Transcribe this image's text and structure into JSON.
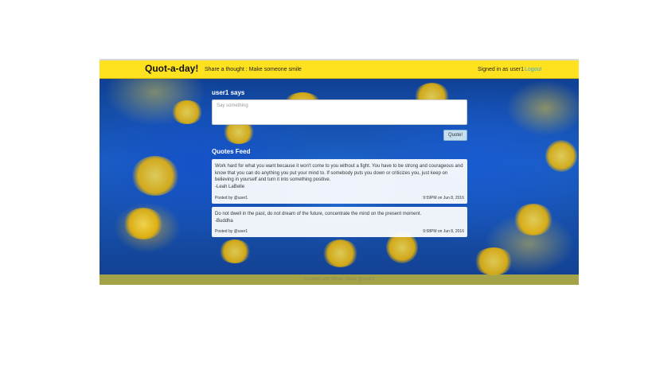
{
  "navbar": {
    "brand": "Quot-a-day!",
    "tagline": "Share a thought : Make someone smile",
    "signed_in": "Signed in as user1",
    "logout": "Logout"
  },
  "compose": {
    "heading": "user1 says",
    "placeholder": "Say something",
    "button_label": "Quote!"
  },
  "feed": {
    "title": "Quotes Feed",
    "quotes": [
      {
        "text": "Work hard for what you want because it won't come to you without a fight. You have to be strong and courageous and know that you can do anything you put your mind to. If somebody puts you down or criticizes you, just keep on believing in yourself and turn it into something positive.",
        "author": "-Leah LaBelle",
        "posted_by": "Posted by @user1",
        "timestamp": "9:59PM on Jun 8, 2016"
      },
      {
        "text": "Do not dwell in the past, do not dream of the future, concentrate the mind on the present moment.",
        "author": "-Buddha",
        "posted_by": "Posted by @user1",
        "timestamp": "9:58PM on Jun 8, 2016"
      }
    ]
  },
  "footer": {
    "text": "Created with Mean Stack @user1"
  },
  "colors": {
    "navbar": "#ffe21f",
    "link": "#3aa5d8",
    "background": "#1b5fc4"
  }
}
